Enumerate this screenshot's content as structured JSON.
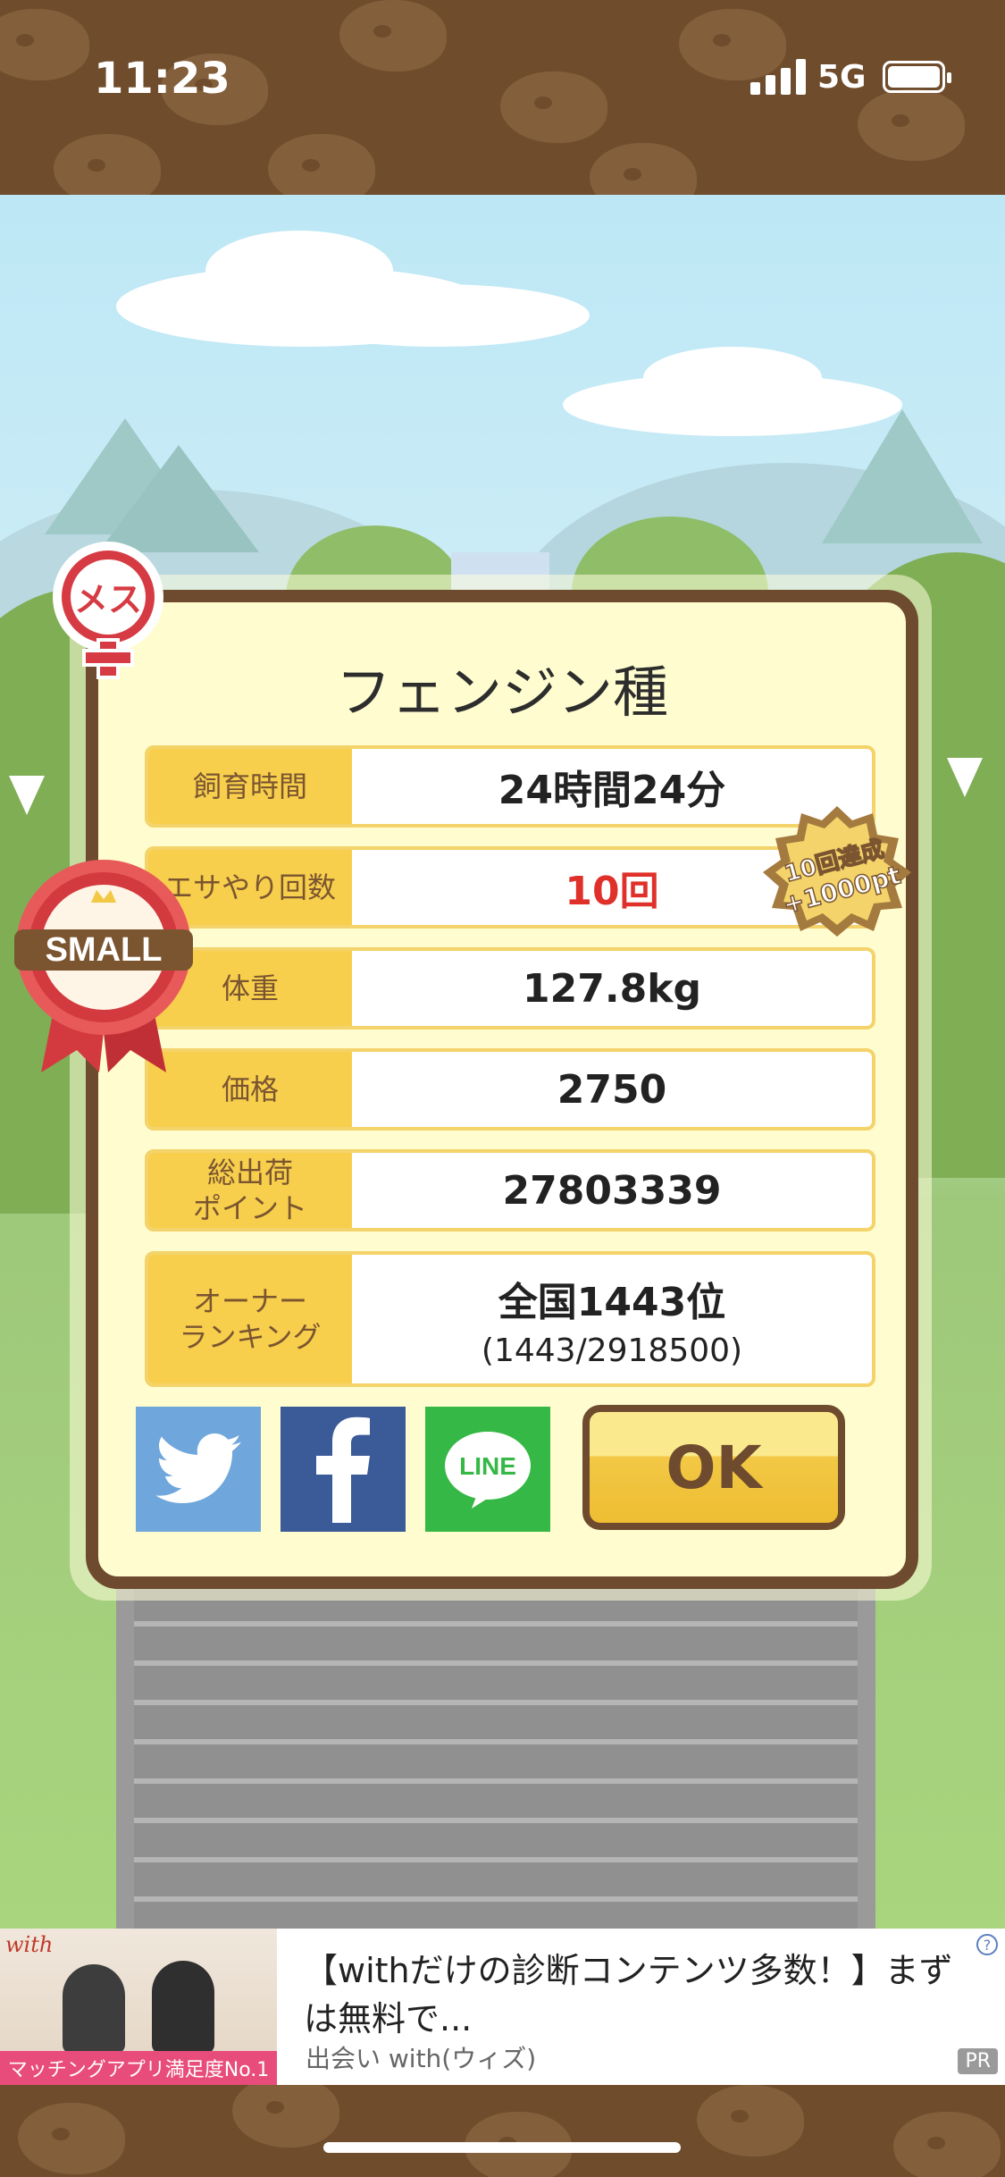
{
  "status_bar": {
    "time": "11:23",
    "network": "5G"
  },
  "badges": {
    "gender": "メス",
    "size": "SMALL",
    "achievement_line1": "10回達成",
    "achievement_line2": "+1000pt"
  },
  "dialog": {
    "title": "フェンジン種",
    "rows": [
      {
        "label": "飼育時間",
        "value": "24時間24分"
      },
      {
        "label": "エサやり回数",
        "value": "10回"
      },
      {
        "label": "体重",
        "value": "127.8kg"
      },
      {
        "label": "価格",
        "value": "2750"
      },
      {
        "label": "総出荷\nポイント",
        "value": "27803339"
      },
      {
        "label": "オーナー\nランキング",
        "value": "全国1443位",
        "sub": "(1443/2918500)"
      }
    ],
    "share": {
      "line_label": "LINE"
    },
    "ok_label": "OK"
  },
  "ad": {
    "brand": "with",
    "image_caption": "マッチングアプリ満足度No.1",
    "title": "【withだけの診断コンテンツ多数！】まずは無料で...",
    "source": "出会い with(ウィズ)",
    "pr": "PR",
    "info": "?"
  },
  "colors": {
    "frame_brown": "#6e4b2e",
    "label_yellow": "#f7cf4d",
    "highlight_red": "#e0302a",
    "twitter": "#6fa6dc",
    "facebook": "#3b5a98",
    "line": "#35b845"
  }
}
